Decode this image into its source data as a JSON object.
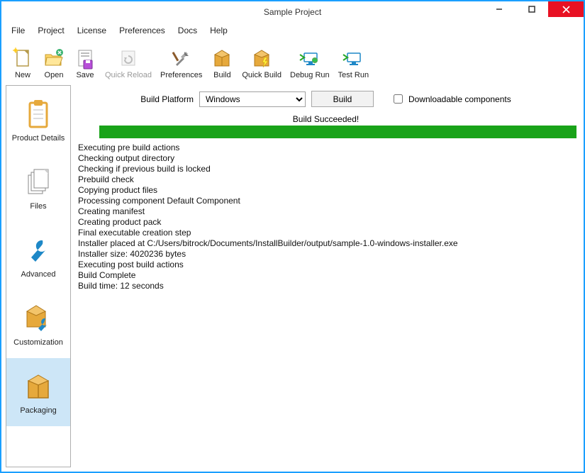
{
  "window": {
    "title": "Sample Project"
  },
  "menu": {
    "items": [
      "File",
      "Project",
      "License",
      "Preferences",
      "Docs",
      "Help"
    ]
  },
  "toolbar": {
    "new": "New",
    "open": "Open",
    "save": "Save",
    "quick_reload": "Quick Reload",
    "preferences": "Preferences",
    "build": "Build",
    "quick_build": "Quick Build",
    "debug_run": "Debug Run",
    "test_run": "Test Run"
  },
  "side": {
    "product_details": "Product Details",
    "files": "Files",
    "advanced": "Advanced",
    "customization": "Customization",
    "packaging": "Packaging"
  },
  "build_panel": {
    "platform_label": "Build Platform",
    "platform_value": "Windows",
    "build_button": "Build",
    "downloadable_label": "Downloadable components",
    "status": "Build Succeeded!"
  },
  "log": [
    "Executing pre build actions",
    "Checking output directory",
    "Checking if previous build is locked",
    "Prebuild check",
    "Copying product files",
    "Processing component Default Component",
    "Creating manifest",
    "Creating product pack",
    "Final executable creation step",
    "Installer placed at C:/Users/bitrock/Documents/InstallBuilder/output/sample-1.0-windows-installer.exe",
    "Installer size: 4020236 bytes",
    "Executing post build actions",
    "Build Complete",
    "Build time: 12 seconds"
  ]
}
